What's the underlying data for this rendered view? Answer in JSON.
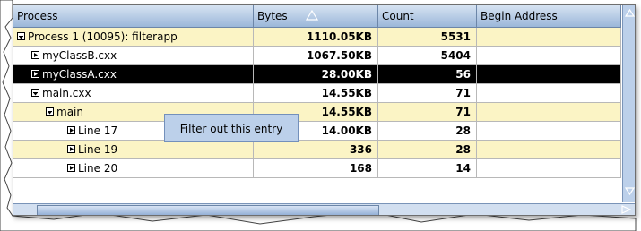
{
  "columns": [
    "Process",
    "Bytes",
    "Count",
    "Begin Address"
  ],
  "sort": {
    "column": "Bytes",
    "icon": "sort-ascending-triangle-icon"
  },
  "rows": [
    {
      "name": "Process 1 (10095): filterapp",
      "bytes": "1110.05KB",
      "count": "5531",
      "begin": "",
      "level": 0,
      "expanded": true,
      "style": "alt"
    },
    {
      "name": "myClassB.cxx",
      "bytes": "1067.50KB",
      "count": "5404",
      "begin": "",
      "level": 1,
      "expanded": false,
      "style": ""
    },
    {
      "name": "myClassA.cxx",
      "bytes": "28.00KB",
      "count": "56",
      "begin": "",
      "level": 1,
      "expanded": false,
      "style": "sel"
    },
    {
      "name": "main.cxx",
      "bytes": "14.55KB",
      "count": "71",
      "begin": "",
      "level": 1,
      "expanded": true,
      "style": ""
    },
    {
      "name": "main",
      "bytes": "14.55KB",
      "count": "71",
      "begin": "",
      "level": 2,
      "expanded": true,
      "style": "alt"
    },
    {
      "name": "Line 17",
      "bytes": "14.00KB",
      "count": "28",
      "begin": "",
      "level": 3,
      "expanded": false,
      "style": ""
    },
    {
      "name": "Line 19",
      "bytes": "336",
      "count": "28",
      "begin": "",
      "level": 3,
      "expanded": false,
      "style": "alt"
    },
    {
      "name": "Line 20",
      "bytes": "168",
      "count": "14",
      "begin": "",
      "level": 3,
      "expanded": false,
      "style": ""
    }
  ],
  "tooltip": "Filter out this entry",
  "colors": {
    "header": "#9bb7d9",
    "alt_row": "#fbf4c5",
    "selected_row": "#000000",
    "tooltip_bg": "#bcd0ea",
    "scrollbar": "#bcd0ea"
  }
}
